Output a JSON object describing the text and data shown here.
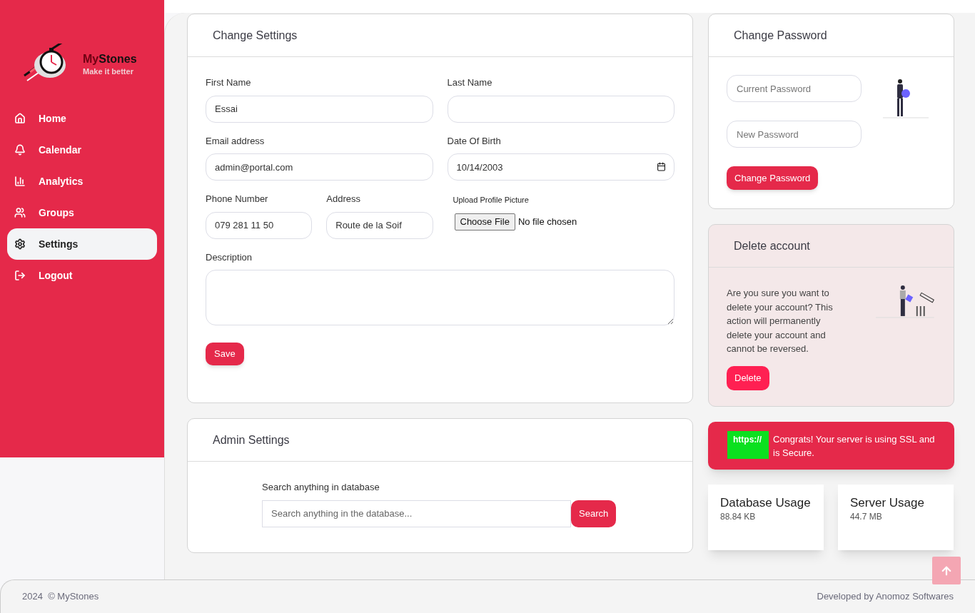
{
  "brand": {
    "name_parts": [
      "My",
      "Stones"
    ],
    "tagline": "Make it better"
  },
  "sidebar": {
    "items": [
      {
        "label": "Home",
        "kind": "home",
        "selected": false
      },
      {
        "label": "Calendar",
        "kind": "bell",
        "selected": false
      },
      {
        "label": "Analytics",
        "kind": "chart",
        "selected": false
      },
      {
        "label": "Groups",
        "kind": "users",
        "selected": false
      },
      {
        "label": "Settings",
        "kind": "gear",
        "selected": true
      },
      {
        "label": "Logout",
        "kind": "logout",
        "selected": false
      }
    ]
  },
  "change_settings": {
    "title": "Change Settings",
    "first_name": {
      "label": "First Name",
      "value": "Essai"
    },
    "last_name": {
      "label": "Last Name"
    },
    "email": {
      "label": "Email address",
      "value": "admin@portal.com"
    },
    "date_of_birth": {
      "label": "Date Of Birth",
      "value": "10/14/2003"
    },
    "phone": {
      "label": "Phone Number",
      "value": "079 281 11 50"
    },
    "address": {
      "label": "Address",
      "value": "Route de la Soif"
    },
    "upload": {
      "label": "Upload Profile Picture",
      "button": "Choose File",
      "status": "No file chosen"
    },
    "description": {
      "label": "Description"
    },
    "save_button": "Save"
  },
  "admin_settings": {
    "title": "Admin Settings",
    "search_label": "Search anything in database",
    "search_placeholder": "Search anything in the database...",
    "search_button": "Search"
  },
  "change_password": {
    "title": "Change Password",
    "current_placeholder": "Current Password",
    "new_placeholder": "New Password",
    "button": "Change Password"
  },
  "delete_account": {
    "title": "Delete account",
    "text": "Are you sure you want to delete your account? This action will permanently delete your account and cannot be reversed.",
    "button": "Delete"
  },
  "ssl_notice": {
    "badge": "https://",
    "text": "Congrats! Your server is using SSL and is Secure."
  },
  "usage": [
    {
      "title": "Database Usage",
      "value": "88.84 KB"
    },
    {
      "title": "Server Usage",
      "value": "44.7 MB"
    }
  ],
  "footer": {
    "copyright": "2024  © MyStones",
    "credit": "Developed by Anomoz Softwares"
  }
}
